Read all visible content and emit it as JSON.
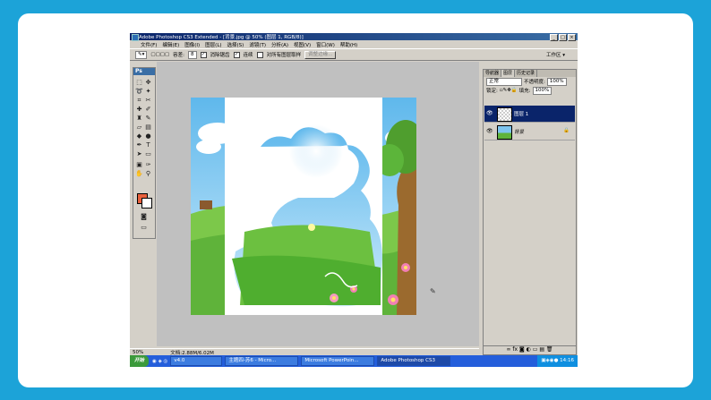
{
  "window": {
    "title": "Adobe Photoshop CS3 Extended - [背景.jpg @ 50% (图层 1, RGB/8)]",
    "controls": [
      "_",
      "□",
      "×"
    ]
  },
  "menu": [
    "文件(F)",
    "编辑(E)",
    "图像(I)",
    "图层(L)",
    "选择(S)",
    "滤镜(T)",
    "分析(A)",
    "视图(V)",
    "窗口(W)",
    "帮助(H)"
  ],
  "options": {
    "tolerance_label": "容差:",
    "tolerance_value": "8",
    "anti_alias": "消除锯齿",
    "contiguous": "连续",
    "sample_all": "对所有图层取样",
    "refine_edge": "调整边缘...",
    "workspace": "工作区 ▾"
  },
  "toolbox": {
    "header": "Ps"
  },
  "panel": {
    "tabs": [
      "导航器",
      "图层",
      "历史记录"
    ],
    "blend_mode": "正常",
    "opacity_label": "不透明度:",
    "opacity_value": "100%",
    "lock_label": "锁定:",
    "fill_label": "填充:",
    "fill_value": "100%",
    "layers": [
      {
        "name": "图层 1",
        "selected": true
      },
      {
        "name": "背景",
        "selected": false
      }
    ]
  },
  "status": {
    "zoom": "50%",
    "doc": "文档:2.88M/6.02M"
  },
  "taskbar": {
    "start": "开始",
    "items": [
      "v4.0",
      "主题四-苏6 - Micro...",
      "Microsoft PowerPoin...",
      "Adobe Photoshop CS3"
    ],
    "clock": "14:16"
  },
  "colors": {
    "foreground": "#e8603c",
    "background": "#ffffff",
    "accent": "#0a246a"
  }
}
